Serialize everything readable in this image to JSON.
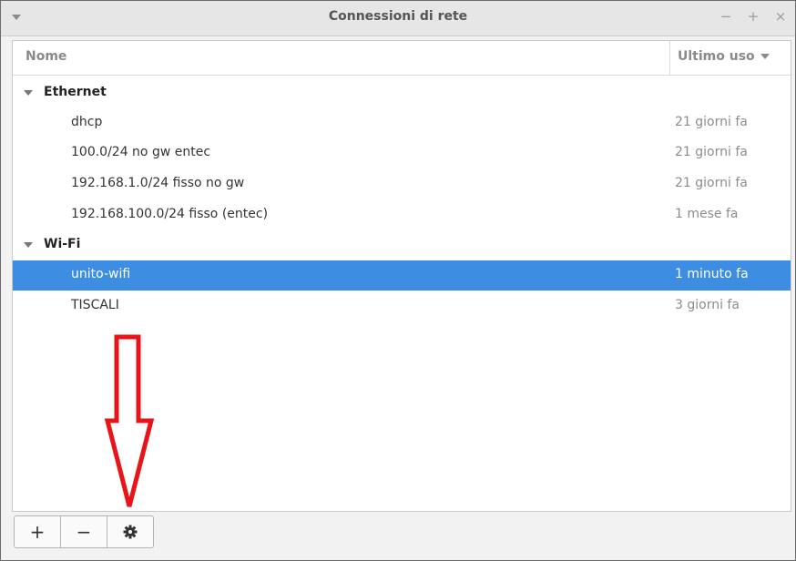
{
  "window": {
    "title": "Connessioni di rete",
    "controls": {
      "minimize": "−",
      "maximize": "+",
      "close": "×"
    }
  },
  "list": {
    "columns": {
      "name": "Nome",
      "last_used": "Ultimo uso"
    },
    "groups": [
      {
        "label": "Ethernet",
        "connections": [
          {
            "name": "dhcp",
            "last_used": "21 giorni fa"
          },
          {
            "name": "100.0/24 no gw entec",
            "last_used": "21 giorni fa"
          },
          {
            "name": "192.168.1.0/24 fisso no gw",
            "last_used": "21 giorni fa"
          },
          {
            "name": "192.168.100.0/24 fisso (entec)",
            "last_used": "1 mese fa"
          }
        ]
      },
      {
        "label": "Wi-Fi",
        "connections": [
          {
            "name": "unito-wifi",
            "last_used": "1 minuto fa",
            "selected": true
          },
          {
            "name": "TISCALI",
            "last_used": "3 giorni fa"
          }
        ]
      }
    ]
  },
  "toolbar": {
    "add": "+",
    "remove": "−",
    "settings_icon": "gear-icon"
  },
  "colors": {
    "selection": "#3d8ee3",
    "annotation_arrow": "#e8141a"
  }
}
